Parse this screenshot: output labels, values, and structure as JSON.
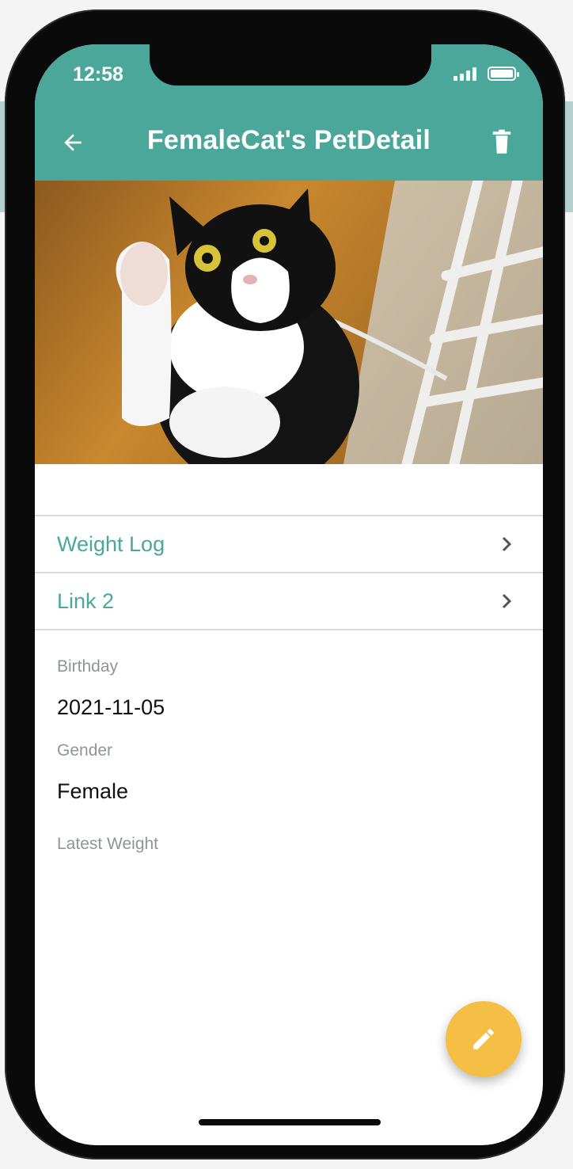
{
  "status_bar": {
    "time": "12:58"
  },
  "toolbar": {
    "title": "FemaleCat's PetDetail"
  },
  "links": [
    {
      "label": "Weight Log"
    },
    {
      "label": "Link 2"
    }
  ],
  "details": {
    "birthday": {
      "label": "Birthday",
      "value": "2021-11-05"
    },
    "gender": {
      "label": "Gender",
      "value": "Female"
    },
    "latest_weight": {
      "label": "Latest Weight",
      "value": ""
    }
  },
  "colors": {
    "accent": "#4ba79a",
    "fab": "#f4bf44"
  },
  "icons": {
    "back": "arrow-left-icon",
    "delete": "trash-icon",
    "chevron": "chevron-right-icon",
    "edit": "pencil-icon"
  }
}
